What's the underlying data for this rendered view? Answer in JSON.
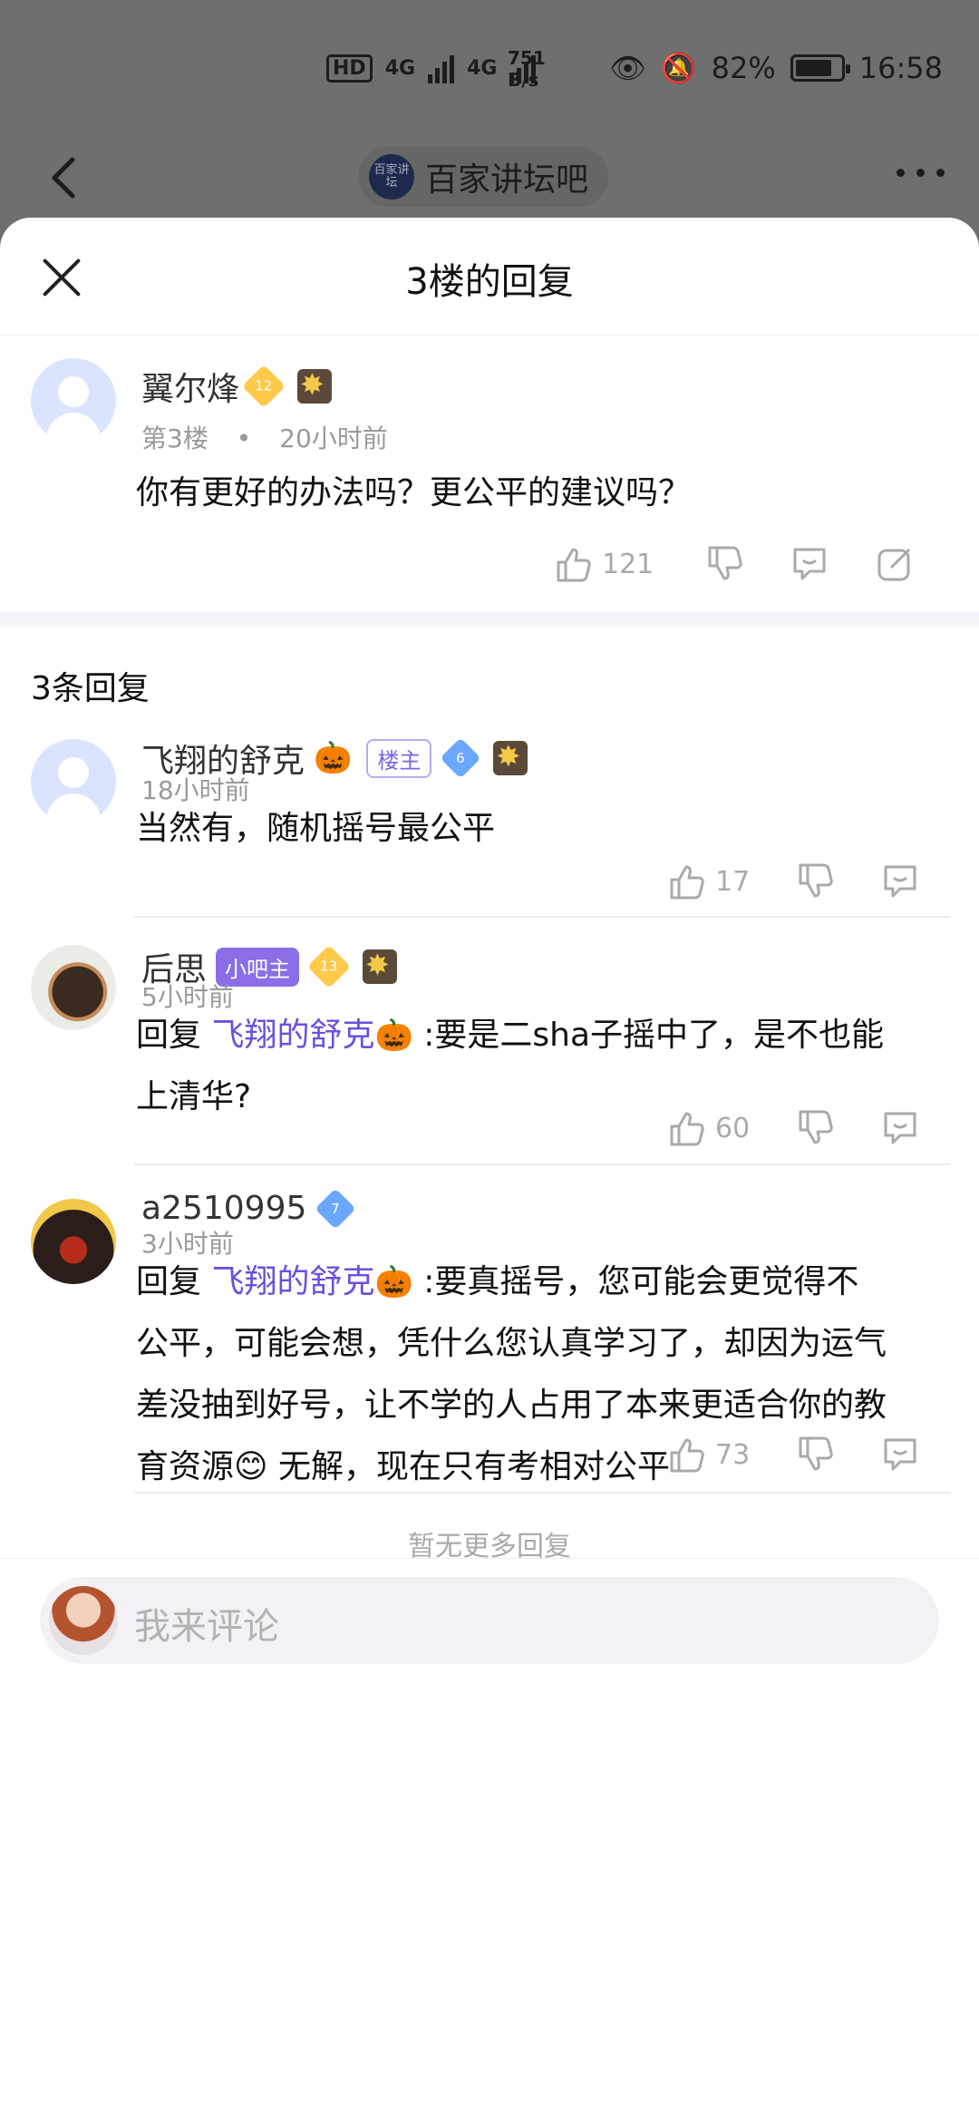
{
  "status_bar": {
    "hd": "HD",
    "net1": "4G",
    "net2": "4G",
    "speed_value": "751",
    "speed_unit": "B/s",
    "battery": "82%",
    "battery_level": 0.82,
    "time": "16:58"
  },
  "nav": {
    "forum_logo": "百家讲坛",
    "forum_name": "百家讲坛吧"
  },
  "sheet": {
    "title": "3楼的回复"
  },
  "post": {
    "username": "翼尔烽",
    "level": "12",
    "floor": "第3楼",
    "dot": "•",
    "time": "20小时前",
    "content": "你有更好的办法吗？更公平的建议吗？",
    "likes": "121"
  },
  "replies_header": "3条回复",
  "replies": [
    {
      "username": "飞翔的舒克",
      "emoji": "🎃",
      "badge": "楼主",
      "level": "6",
      "time": "18小时前",
      "content": "当然有，随机摇号最公平",
      "likes": "17"
    },
    {
      "username": "后思",
      "badge": "小吧主",
      "level": "13",
      "time": "5小时前",
      "reply_prefix": "回复 ",
      "mention": "飞翔的舒克",
      "mention_emoji": "🎃",
      "content_line1": "  :要是二sha子摇中了，是不也能",
      "content_line2": "上清华?",
      "likes": "60"
    },
    {
      "username": "a2510995",
      "level": "7",
      "time": "3小时前",
      "reply_prefix": "回复 ",
      "mention": "飞翔的舒克",
      "mention_emoji": "🎃",
      "content_line1": "  :要真摇号，您可能会更觉得不",
      "content_line2": "公平，可能会想，凭什么您认真学习了，却因为运气",
      "content_line3": "差没抽到好号，让不学的人占用了本来更适合你的教",
      "content_line4a": "育资源",
      "content_emoji": "😊",
      "content_line4b": " 无解，现在只有考相对公平",
      "likes": "73"
    }
  ],
  "no_more": "暂无更多回复",
  "comment_placeholder": "我来评论",
  "icons": [
    "back-icon",
    "more-icon",
    "close-icon",
    "like-icon",
    "dislike-icon",
    "comment-icon",
    "share-icon"
  ]
}
